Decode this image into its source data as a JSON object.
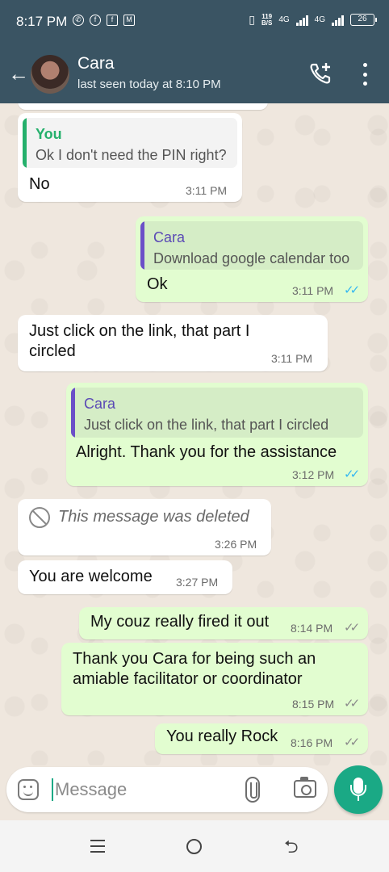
{
  "status_bar": {
    "time": "8:17 PM",
    "speed_value": "119",
    "speed_unit": "B/S",
    "network_1": "4G",
    "network_2": "4G",
    "battery": "26"
  },
  "header": {
    "contact_name": "Cara",
    "last_seen": "last seen today at 8:10 PM"
  },
  "messages": [
    {
      "direction": "incoming",
      "quote_author": "You",
      "quote_text": "Ok I don't need the PIN right?",
      "text": "No",
      "time": "3:11 PM"
    },
    {
      "direction": "outgoing",
      "quote_author": "Cara",
      "quote_text": "Download google calendar too",
      "text": "Ok",
      "time": "3:11 PM",
      "status": "read"
    },
    {
      "direction": "incoming",
      "text_line1": "Just click on the link, that part I",
      "text_line2": "circled",
      "time": "3:11 PM"
    },
    {
      "direction": "outgoing",
      "quote_author": "Cara",
      "quote_text": "Just click on the link, that part I circled",
      "text": "Alright. Thank you for the assistance",
      "time": "3:12 PM",
      "status": "read"
    },
    {
      "direction": "incoming",
      "text": "This message was deleted",
      "time": "3:26 PM",
      "deleted": true
    },
    {
      "direction": "incoming",
      "text": "You are welcome",
      "time": "3:27 PM"
    },
    {
      "direction": "outgoing",
      "text": "My couz really fired it out",
      "time": "8:14 PM",
      "status": "delivered"
    },
    {
      "direction": "outgoing",
      "text_line1": "Thank you Cara for being such an",
      "text_line2": "amiable facilitator or coordinator",
      "time": "8:15 PM",
      "status": "delivered"
    },
    {
      "direction": "outgoing",
      "text": "You really Rock",
      "time": "8:16 PM",
      "status": "delivered"
    }
  ],
  "composer": {
    "placeholder": "Message"
  },
  "colors": {
    "header": "#3a5463",
    "outgoing_bubble": "#e2fdd0",
    "incoming_bubble": "#ffffff",
    "accent": "#1aa985",
    "read_ticks": "#34b7f1"
  },
  "icons": {
    "back": "arrow-left-icon",
    "add_call": "add-call-icon",
    "menu": "more-vertical-icon",
    "emoji": "sticker-icon",
    "attach": "paperclip-icon",
    "camera": "camera-icon",
    "mic": "mic-icon"
  }
}
